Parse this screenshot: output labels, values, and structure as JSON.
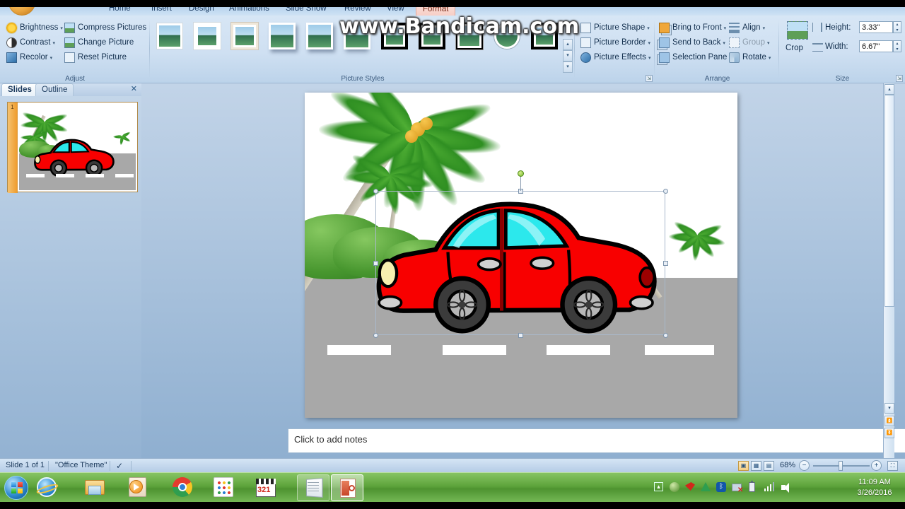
{
  "app": {
    "tabs": [
      "Home",
      "Insert",
      "Design",
      "Animations",
      "Slide Show",
      "Review",
      "View",
      "Format"
    ],
    "active_tab": "Format"
  },
  "watermark": "www.Bandicam.com",
  "ribbon": {
    "groups": [
      {
        "name": "Adjust",
        "label": "Adjust",
        "commands": [
          {
            "label": "Brightness",
            "icon": "brightness-icon",
            "dropdown": true
          },
          {
            "label": "Contrast",
            "icon": "contrast-icon",
            "dropdown": true
          },
          {
            "label": "Recolor",
            "icon": "recolor-icon",
            "dropdown": true
          },
          {
            "label": "Compress Pictures",
            "icon": "compress-pictures-icon",
            "dropdown": false
          },
          {
            "label": "Change Picture",
            "icon": "change-picture-icon",
            "dropdown": false
          },
          {
            "label": "Reset Picture",
            "icon": "reset-picture-icon",
            "dropdown": false
          }
        ]
      },
      {
        "name": "PictureStyles",
        "label": "Picture Styles",
        "style_count": 11,
        "commands": [
          {
            "label": "Picture Shape",
            "icon": "picture-shape-icon",
            "dropdown": true
          },
          {
            "label": "Picture Border",
            "icon": "picture-border-icon",
            "dropdown": true
          },
          {
            "label": "Picture Effects",
            "icon": "picture-effects-icon",
            "dropdown": true
          }
        ]
      },
      {
        "name": "Arrange",
        "label": "Arrange",
        "commands": [
          {
            "label": "Bring to Front",
            "icon": "bring-to-front-icon",
            "dropdown": true
          },
          {
            "label": "Send to Back",
            "icon": "send-to-back-icon",
            "dropdown": true
          },
          {
            "label": "Selection Pane",
            "icon": "selection-pane-icon",
            "dropdown": false
          },
          {
            "label": "Align",
            "icon": "align-icon",
            "dropdown": true
          },
          {
            "label": "Group",
            "icon": "group-icon",
            "dropdown": true
          },
          {
            "label": "Rotate",
            "icon": "rotate-icon",
            "dropdown": true
          }
        ]
      },
      {
        "name": "Size",
        "label": "Size",
        "crop_label": "Crop",
        "height_label": "Height:",
        "height_value": "3.33\"",
        "width_label": "Width:",
        "width_value": "6.67\""
      }
    ]
  },
  "slide_pane": {
    "tabs": [
      "Slides",
      "Outline"
    ],
    "active_tab": "Slides",
    "close_glyph": "✕",
    "slide_number": "1"
  },
  "notes": {
    "placeholder": "Click to add notes"
  },
  "status_bar": {
    "slide_count_text": "Slide 1 of 1",
    "theme_text": "\"Office Theme\"",
    "spellcheck_icon": "spellcheck-icon",
    "zoom_percent": "68%",
    "zoom_out_glyph": "−",
    "zoom_in_glyph": "+",
    "fit_glyph": "⛶",
    "view_buttons": [
      "normal-view",
      "slide-sorter-view",
      "slideshow-view"
    ]
  },
  "taskbar": {
    "start": "start-orb",
    "items": [
      {
        "name": "internet-explorer-icon"
      },
      {
        "name": "windows-explorer-icon"
      },
      {
        "name": "media-player-icon"
      },
      {
        "name": "google-chrome-icon"
      },
      {
        "name": "app-grid-icon"
      },
      {
        "name": "video-editor-321-icon",
        "label": "321"
      },
      {
        "name": "notepad-window-icon"
      },
      {
        "name": "powerpoint-window-icon"
      }
    ],
    "tray_icons": [
      "show-hidden-icons",
      "safety-icon",
      "antivirus-icon",
      "triangle-icon",
      "bluetooth-icon",
      "network-removable-icon",
      "battery-icon",
      "signal-icon",
      "volume-icon"
    ],
    "time": "11:09 AM",
    "date": "3/26/2016"
  },
  "slide_art": {
    "title": "red-car-on-road-clipart",
    "colors": {
      "car_body": "#f80000",
      "car_outline": "#000000",
      "window_glass": "#2ce8ec",
      "road": "#a8a8a8",
      "lane_marking": "#ffffff",
      "palm_green": "#35a022",
      "sky": "#ffffff",
      "trunk": "#c8c3b4"
    },
    "elements": [
      "large-palm-tree",
      "small-palm-tree",
      "bushes",
      "distant-palm-tree",
      "road",
      "lane-markings",
      "red-car"
    ],
    "lane_marking_count": 4
  },
  "selection": {
    "handles": 8,
    "rotation_handle": true
  }
}
